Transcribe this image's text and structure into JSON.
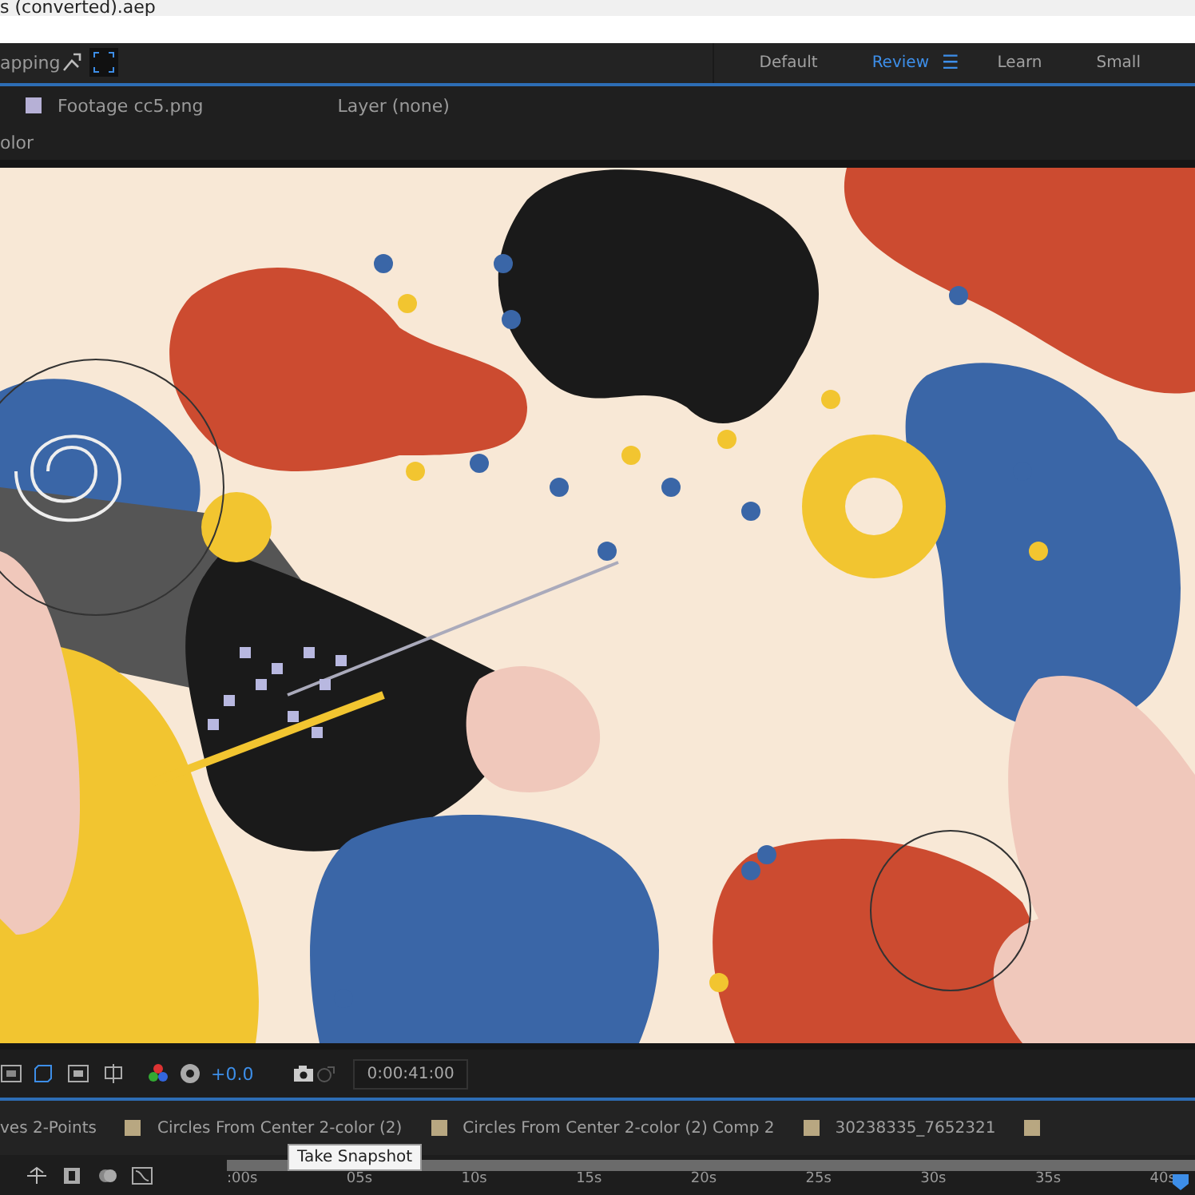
{
  "title_bar": {
    "title": "s (converted).aep"
  },
  "toolbar": {
    "snapping_label": "apping",
    "menu_glyph": "☰",
    "workspaces": [
      {
        "label": "Default",
        "selected": false
      },
      {
        "label": "Review",
        "selected": true
      },
      {
        "label": "Learn",
        "selected": false
      },
      {
        "label": "Small",
        "selected": false
      }
    ]
  },
  "viewer_tabs": {
    "footage": "Footage cc5.png",
    "layer": "Layer (none)",
    "panel_label": "olor"
  },
  "viewer_controls": {
    "exposure": "+0.0",
    "timecode": "0:00:41:00",
    "tooltip": "Take Snapshot"
  },
  "comp_tabs": [
    {
      "label": "ves 2-Points",
      "swatch": false
    },
    {
      "label": "Circles From Center 2-color (2)",
      "swatch": true
    },
    {
      "label": "Circles From Center 2-color (2) Comp 2",
      "swatch": true
    },
    {
      "label": "30238335_7652321",
      "swatch": true
    }
  ],
  "trailing_swatch": true,
  "timeline": {
    "ticks": [
      ":00s",
      "05s",
      "10s",
      "15s",
      "20s",
      "25s",
      "30s",
      "35s",
      "40s"
    ]
  }
}
